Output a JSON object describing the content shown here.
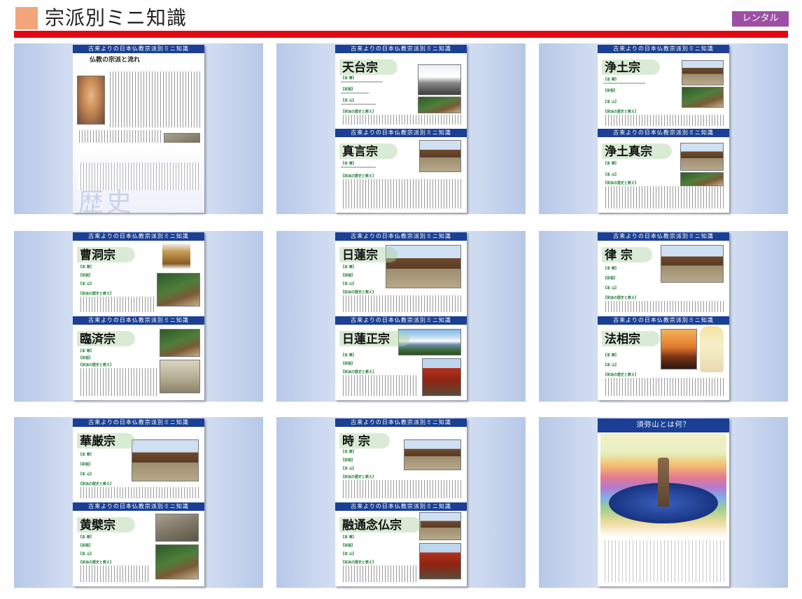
{
  "header": {
    "title": "宗派別ミニ知識",
    "badge": "レンタル"
  },
  "band_text": "古来よりの日本仏教宗派別ミニ知識",
  "labels": {
    "honzon": "【本 尊】",
    "sosan": "【宗祖】",
    "honzan": "【本 山】",
    "history": "【宗派の歴史と教え】"
  },
  "cards": {
    "intro": {
      "subtitle": "仏教の宗派と流れ",
      "watermark": "歴史"
    },
    "tendai": {
      "title": "天台宗"
    },
    "shingon": {
      "title": "真言宗"
    },
    "jodo": {
      "title": "浄土宗"
    },
    "jodoshin": {
      "title": "浄土真宗"
    },
    "soto": {
      "title": "曹洞宗"
    },
    "rinzai": {
      "title": "臨済宗"
    },
    "nichiren": {
      "title": "日蓮宗"
    },
    "nichirenshoshu": {
      "title": "日蓮正宗"
    },
    "ritsu": {
      "title": "律 宗"
    },
    "hosso": {
      "title": "法相宗"
    },
    "kegon": {
      "title": "華厳宗"
    },
    "obaku": {
      "title": "黄檗宗"
    },
    "ji": {
      "title": "時 宗"
    },
    "yuzunembutsu": {
      "title": "融通念仏宗"
    },
    "shumisen": {
      "title": "須弥山とは何？"
    }
  }
}
